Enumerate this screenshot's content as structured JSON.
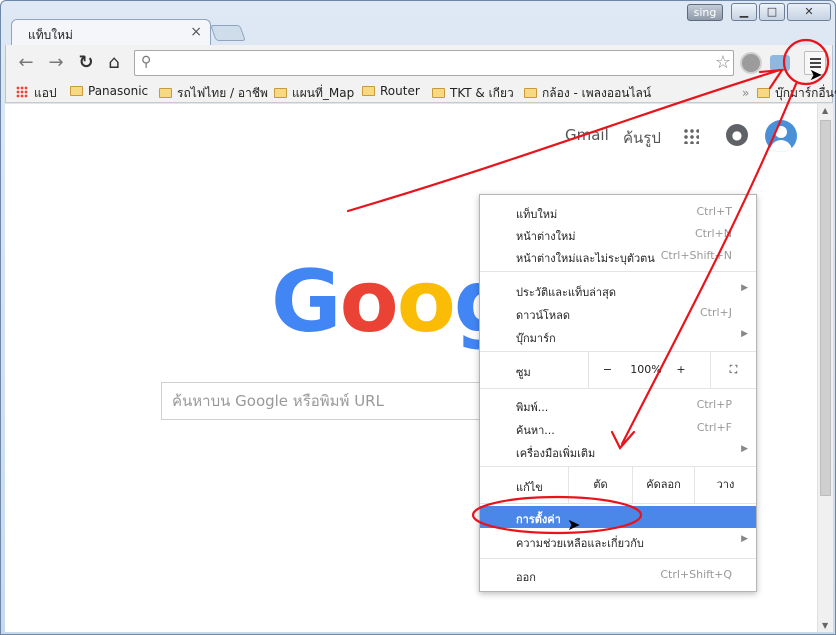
{
  "window": {
    "tab_title": "แท็บใหม่",
    "user_badge": "sing",
    "min_label": "▁",
    "max_label": "□",
    "close_label": "✕"
  },
  "toolbar": {
    "back_icon": "back-arrow-icon",
    "forward_icon": "forward-arrow-icon",
    "reload_icon": "reload-icon",
    "home_icon": "home-icon",
    "address_value": ""
  },
  "bookmarks": {
    "items": [
      {
        "label": "แอป",
        "type": "apps"
      },
      {
        "label": "Panasonic",
        "type": "folder"
      },
      {
        "label": "รถไฟไทย / อาชีพ",
        "type": "folder"
      },
      {
        "label": "แผนที่_Map",
        "type": "folder"
      },
      {
        "label": "Router",
        "type": "folder"
      },
      {
        "label": "TKT & เกียว",
        "type": "folder"
      },
      {
        "label": "กล้อง - เพลงออนไลน์",
        "type": "folder"
      }
    ],
    "other_label": "บุ๊กมาร์กอื่นๆ"
  },
  "google": {
    "gmail_label": "Gmail",
    "images_label": "ค้นรูป",
    "logo_letters": [
      "G",
      "o",
      "o",
      "g"
    ],
    "logo_colors": [
      "#4285f4",
      "#ea4335",
      "#fbbc05",
      "#4285f4"
    ],
    "search_placeholder": "ค้นหาบน Google หรือพิมพ์ URL"
  },
  "menu": {
    "new_tab": "แท็บใหม่",
    "new_tab_key": "Ctrl+T",
    "new_window": "หน้าต่างใหม่",
    "new_window_key": "Ctrl+N",
    "incognito": "หน้าต่างใหม่และไม่ระบุตัวตน",
    "incognito_key": "Ctrl+Shift+N",
    "history": "ประวัติและแท็บล่าสุด",
    "downloads": "ดาวน์โหลด",
    "downloads_key": "Ctrl+J",
    "bookmarks": "บุ๊กมาร์ก",
    "zoom_label": "ซูม",
    "zoom_minus": "−",
    "zoom_value": "100%",
    "zoom_plus": "+",
    "print": "พิมพ์...",
    "print_key": "Ctrl+P",
    "find": "ค้นหา...",
    "find_key": "Ctrl+F",
    "more_tools": "เครื่องมือเพิ่มเติม",
    "edit_label": "แก้ไข",
    "cut": "ตัด",
    "copy": "คัดลอก",
    "paste": "วาง",
    "settings": "การตั้งค่า",
    "help": "ความช่วยเหลือและเกี่ยวกับ",
    "exit": "ออก",
    "exit_key": "Ctrl+Shift+Q"
  },
  "colors": {
    "accent": "#4a87e8",
    "annotation": "#e8141c"
  }
}
